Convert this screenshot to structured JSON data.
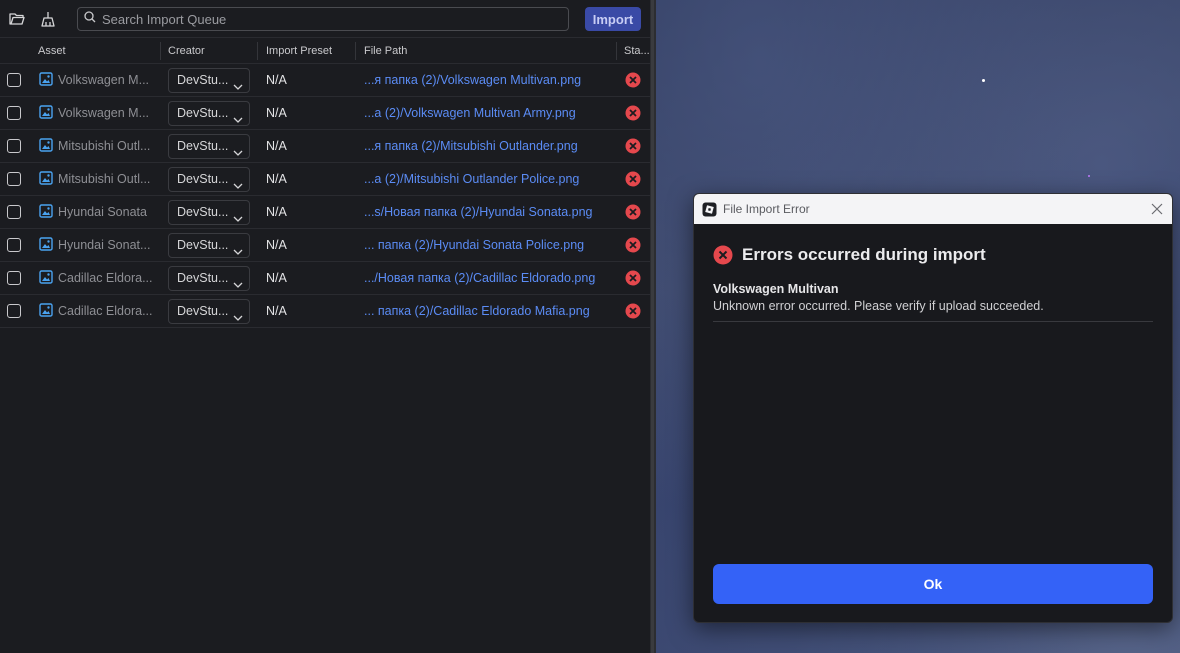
{
  "toolbar": {
    "search_placeholder": "Search Import Queue",
    "import_label": "Import"
  },
  "columns": {
    "asset": "Asset",
    "creator": "Creator",
    "preset": "Import Preset",
    "filepath": "File Path",
    "status": "Sta..."
  },
  "rows": [
    {
      "asset": "Volkswagen M...",
      "creator": "DevStu...",
      "preset": "N/A",
      "filepath": "...я папка (2)/Volkswagen Multivan.png"
    },
    {
      "asset": "Volkswagen M...",
      "creator": "DevStu...",
      "preset": "N/A",
      "filepath": "...а (2)/Volkswagen Multivan Army.png"
    },
    {
      "asset": "Mitsubishi Outl...",
      "creator": "DevStu...",
      "preset": "N/A",
      "filepath": "...я папка (2)/Mitsubishi Outlander.png"
    },
    {
      "asset": "Mitsubishi Outl...",
      "creator": "DevStu...",
      "preset": "N/A",
      "filepath": "...а (2)/Mitsubishi Outlander Police.png"
    },
    {
      "asset": "Hyundai Sonata",
      "creator": "DevStu...",
      "preset": "N/A",
      "filepath": "...s/Новая папка (2)/Hyundai Sonata.png"
    },
    {
      "asset": "Hyundai Sonat...",
      "creator": "DevStu...",
      "preset": "N/A",
      "filepath": "... папка (2)/Hyundai Sonata Police.png"
    },
    {
      "asset": "Cadillac Eldora...",
      "creator": "DevStu...",
      "preset": "N/A",
      "filepath": ".../Новая папка (2)/Cadillac Eldorado.png"
    },
    {
      "asset": "Cadillac Eldora...",
      "creator": "DevStu...",
      "preset": "N/A",
      "filepath": "... папка (2)/Cadillac Eldorado Mafia.png"
    }
  ],
  "dialog": {
    "title": "File Import Error",
    "heading": "Errors occurred during import",
    "item_title": "Volkswagen Multivan",
    "item_message": "Unknown error occurred. Please verify if upload succeeded.",
    "ok_label": "Ok"
  },
  "colors": {
    "accent": "#3462f7",
    "error": "#e5484d",
    "link": "#5b8cf5"
  }
}
